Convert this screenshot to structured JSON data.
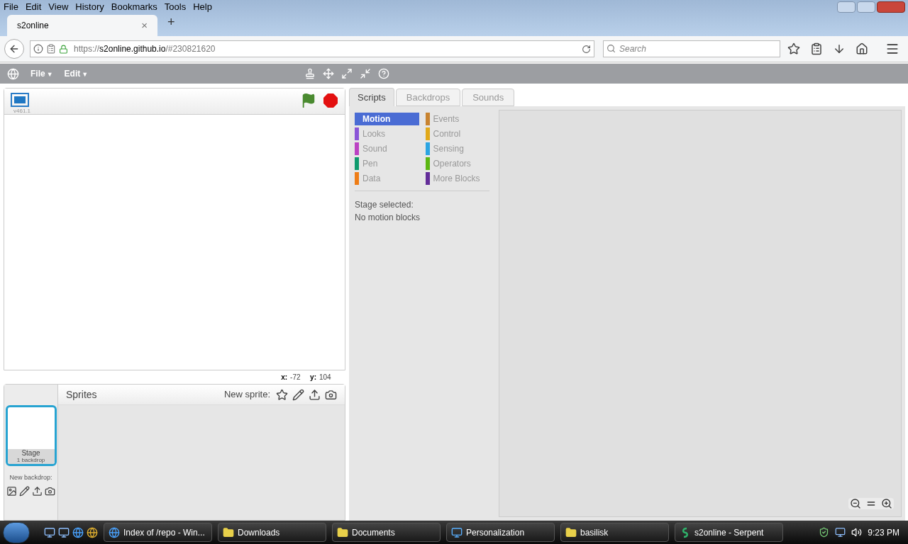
{
  "menu_bar": [
    "File",
    "Edit",
    "View",
    "History",
    "Bookmarks",
    "Tools",
    "Help"
  ],
  "browser_tab": {
    "title": "s2online",
    "close": "×",
    "new_tab": "+"
  },
  "address_bar": {
    "scheme": "https://",
    "host": "s2online.github.io",
    "path": "/#230821620"
  },
  "search_field": {
    "placeholder": "Search"
  },
  "app_menu": [
    {
      "label": "File",
      "caret": "▼"
    },
    {
      "label": "Edit",
      "caret": "▼"
    }
  ],
  "stage": {
    "version": "v461.1",
    "x_label": "x:",
    "x_value": "-72",
    "y_label": "y:",
    "y_value": "104"
  },
  "sprites": {
    "title": "Sprites",
    "new_sprite": "New sprite:",
    "stage_name": "Stage",
    "stage_info": "1 backdrop",
    "new_backdrop": "New backdrop:"
  },
  "tabs": [
    {
      "label": "Scripts",
      "selected": true
    },
    {
      "label": "Backdrops",
      "selected": false
    },
    {
      "label": "Sounds",
      "selected": false
    }
  ],
  "categories": [
    {
      "label": "Motion",
      "color": "#4a6cd4",
      "selected": true
    },
    {
      "label": "Events",
      "color": "#c88330",
      "selected": false
    },
    {
      "label": "Looks",
      "color": "#8a55d7",
      "selected": false
    },
    {
      "label": "Control",
      "color": "#e1a91a",
      "selected": false
    },
    {
      "label": "Sound",
      "color": "#bb42c3",
      "selected": false
    },
    {
      "label": "Sensing",
      "color": "#2ca5e2",
      "selected": false
    },
    {
      "label": "Pen",
      "color": "#0e9a6c",
      "selected": false
    },
    {
      "label": "Operators",
      "color": "#5cb712",
      "selected": false
    },
    {
      "label": "Data",
      "color": "#ee7d16",
      "selected": false
    },
    {
      "label": "More Blocks",
      "color": "#632d99",
      "selected": false
    }
  ],
  "palette_message": [
    "Stage selected:",
    "No motion blocks"
  ],
  "taskbar": {
    "items": [
      {
        "label": "Index of /repo - Win...",
        "kind": "browser"
      },
      {
        "label": "Downloads",
        "kind": "folder"
      },
      {
        "label": "Documents",
        "kind": "folder"
      },
      {
        "label": "Personalization",
        "kind": "monitor"
      },
      {
        "label": "basilisk",
        "kind": "folder"
      },
      {
        "label": "s2online - Serpent",
        "kind": "serpent"
      }
    ],
    "clock": "9:23 PM"
  }
}
